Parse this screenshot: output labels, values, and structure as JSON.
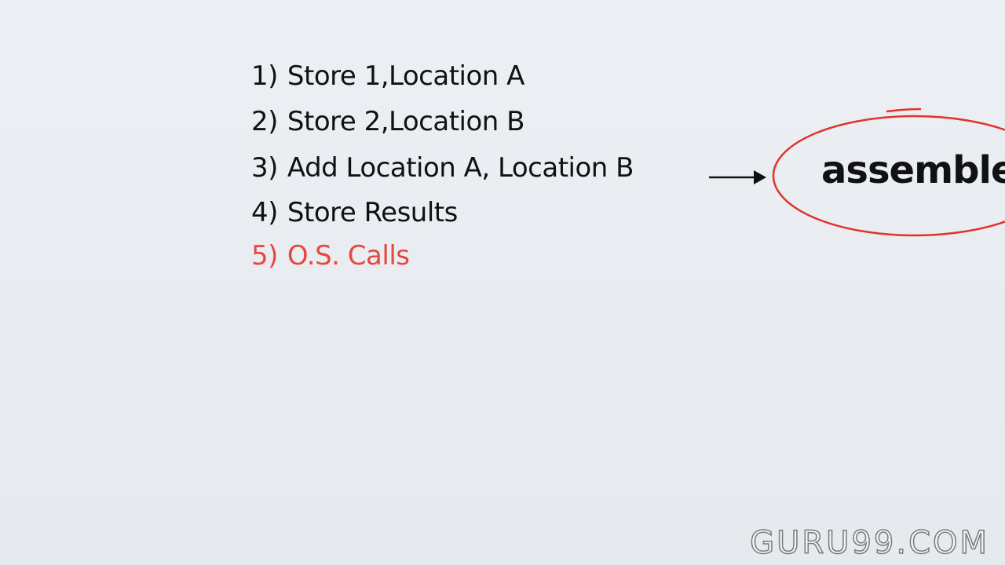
{
  "steps": [
    {
      "number": "1)",
      "text": "Store 1,Location A"
    },
    {
      "number": "2)",
      "text": "Store 2,Location B"
    },
    {
      "number": "3)",
      "text": "Add Location A, Location B"
    },
    {
      "number": "4)",
      "text": "Store Results"
    },
    {
      "number": "5)",
      "text": "O.S. Calls"
    }
  ],
  "callout": {
    "label": "assembler"
  },
  "watermark": "GURU99.COM",
  "colors": {
    "background": "#e9edf1",
    "text": "#111111",
    "highlight": "#e8473d",
    "circle": "#e0332b",
    "arrow": "#111111"
  }
}
